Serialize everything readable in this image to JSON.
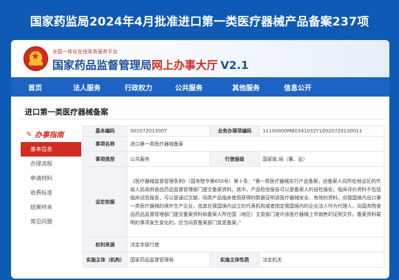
{
  "banner": {
    "headline": "国家药监局2024年4月批准进口第一类医疗器械产品备案237项"
  },
  "header": {
    "subtitle": "全国一体化在线政务服务平台",
    "site_name": "国家药品监督管理局",
    "hall_name": "网上办事大厅",
    "version": "V2.1",
    "logo": "national-emblem-icon"
  },
  "nav": {
    "items": [
      {
        "label": "首页"
      },
      {
        "label": "法人服务"
      },
      {
        "label": "行政权力"
      },
      {
        "label": "公共服务"
      },
      {
        "label": "其他服务"
      },
      {
        "label": "信息公开"
      }
    ]
  },
  "page": {
    "title": "进口第一类医疗器械备案"
  },
  "sidebar": {
    "header": "办事指南",
    "header_icon": "pen-icon",
    "items": [
      {
        "label": "基本信息"
      },
      {
        "label": "办理流程"
      },
      {
        "label": "申请材料"
      },
      {
        "label": "收费标准"
      },
      {
        "label": "结果样本"
      },
      {
        "label": "常见问题"
      }
    ]
  },
  "info": {
    "basic_code_label": "基本编码",
    "basic_code": "00207201300T",
    "biz_code_label": "业务办理项编码",
    "biz_code": "11100000MB0341032Y10020720130011",
    "item_name_label": "事项名称",
    "item_name": "进口第一类医疗器械备案",
    "item_type_label": "事项类型",
    "item_type": "公共服务",
    "level_label": "行使层级",
    "level": "国家级;局（署、会）",
    "basis_label": "设定依据",
    "basis": "《医疗器械监督管理条例》（国务院令第650号）第十条：“第一类医疗器械实行产品备案，由备案人向所在地设区的市级人民政府食品药品监督管理部门提交备案资料。其中，产品检验报告可以是备案人的自检报告；临床评价资料不包括临床试验报告，可以是通过文献、同类产品临床使用获得的数据证明该医疗器械安全、有效的资料。向我国境内出口第一类医疗器械的境外生产企业，由其在我国境内设立的代表机构或者指定我国境内的企业法人作为代理人，向国务院食品药品监督管理部门提交备案资料和备案人所在国（地区）主管部门准许该医疗器械上市销售的证明文件。备案资料载明的事项发生变化的，应当向原备案部门变更备案。”",
    "source_label": "权利来源",
    "source": "法定本级行使",
    "subject_label": "实施主体（机构）",
    "subject": "国家药品监督管理局",
    "nature_label": "实施主体性质",
    "nature": "法定机关"
  }
}
